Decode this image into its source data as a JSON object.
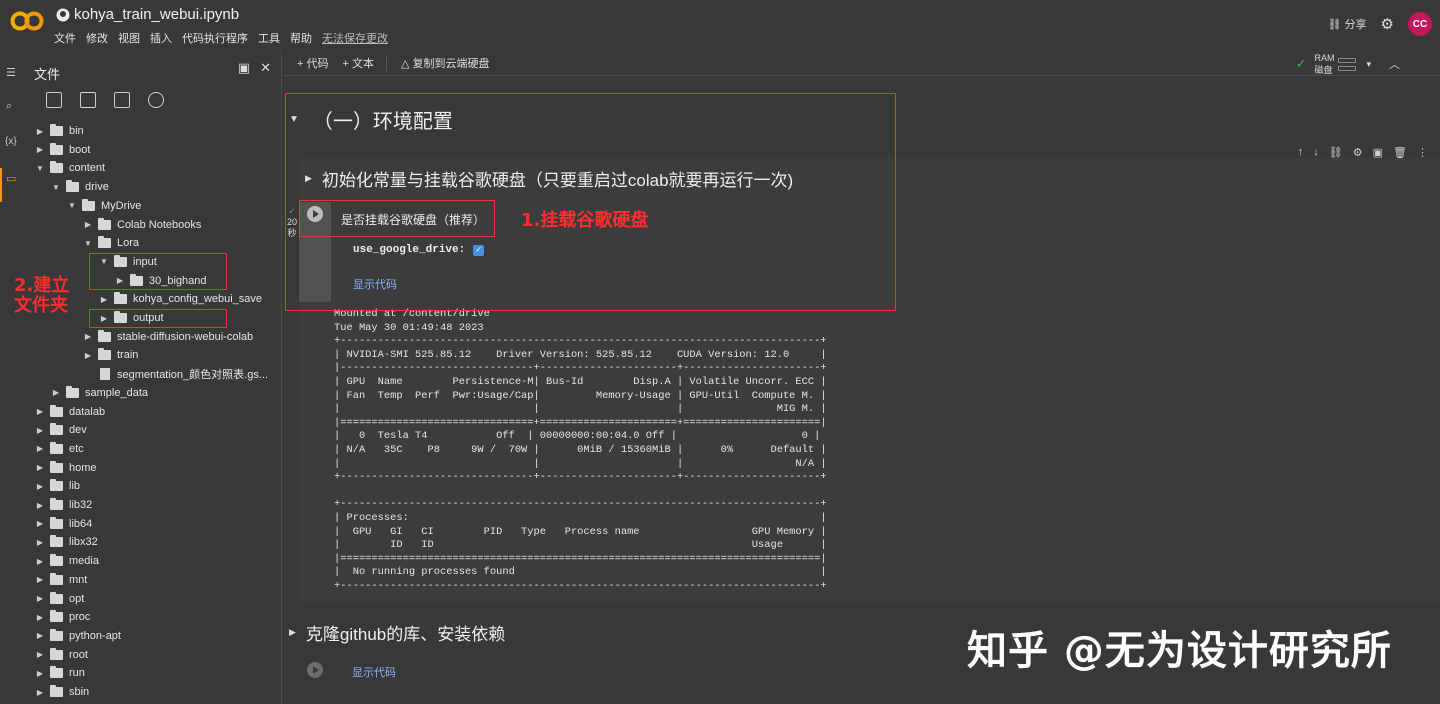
{
  "header": {
    "notebook_title": "kohya_train_webui.ipynb",
    "menu": [
      "文件",
      "修改",
      "视图",
      "插入",
      "代码执行程序",
      "工具",
      "帮助"
    ],
    "unsaved_notice": "无法保存更改",
    "share_label": "分享",
    "avatar_initials": "CC"
  },
  "sidebar": {
    "title": "文件",
    "tree": [
      {
        "label": "bin",
        "depth": 0,
        "expanded": false
      },
      {
        "label": "boot",
        "depth": 0,
        "expanded": false
      },
      {
        "label": "content",
        "depth": 0,
        "expanded": true
      },
      {
        "label": "drive",
        "depth": 1,
        "expanded": true
      },
      {
        "label": "MyDrive",
        "depth": 2,
        "expanded": true
      },
      {
        "label": "Colab Notebooks",
        "depth": 3,
        "expanded": false
      },
      {
        "label": "Lora",
        "depth": 3,
        "expanded": true
      },
      {
        "label": "input",
        "depth": 4,
        "expanded": true
      },
      {
        "label": "30_bighand",
        "depth": 5,
        "expanded": false
      },
      {
        "label": "kohya_config_webui_save",
        "depth": 4,
        "expanded": false
      },
      {
        "label": "output",
        "depth": 4,
        "expanded": false
      },
      {
        "label": "stable-diffusion-webui-colab",
        "depth": 3,
        "expanded": false
      },
      {
        "label": "train",
        "depth": 3,
        "expanded": false
      },
      {
        "label": "segmentation_颜色对照表.gs...",
        "depth": 3,
        "expanded": false,
        "file": true
      },
      {
        "label": "sample_data",
        "depth": 1,
        "expanded": false
      },
      {
        "label": "datalab",
        "depth": 0,
        "expanded": false
      },
      {
        "label": "dev",
        "depth": 0,
        "expanded": false
      },
      {
        "label": "etc",
        "depth": 0,
        "expanded": false
      },
      {
        "label": "home",
        "depth": 0,
        "expanded": false
      },
      {
        "label": "lib",
        "depth": 0,
        "expanded": false
      },
      {
        "label": "lib32",
        "depth": 0,
        "expanded": false
      },
      {
        "label": "lib64",
        "depth": 0,
        "expanded": false
      },
      {
        "label": "libx32",
        "depth": 0,
        "expanded": false
      },
      {
        "label": "media",
        "depth": 0,
        "expanded": false
      },
      {
        "label": "mnt",
        "depth": 0,
        "expanded": false
      },
      {
        "label": "opt",
        "depth": 0,
        "expanded": false
      },
      {
        "label": "proc",
        "depth": 0,
        "expanded": false
      },
      {
        "label": "python-apt",
        "depth": 0,
        "expanded": false
      },
      {
        "label": "root",
        "depth": 0,
        "expanded": false
      },
      {
        "label": "run",
        "depth": 0,
        "expanded": false
      },
      {
        "label": "sbin",
        "depth": 0,
        "expanded": false
      }
    ],
    "annotation": "2.建立\n文件夹"
  },
  "toolbar": {
    "add_code": "+ 代码",
    "add_text": "+ 文本",
    "copy_drive": "复制到云端硬盘",
    "ram_label": "RAM",
    "disk_label": "磁盘"
  },
  "notebook": {
    "section1_title": "（一）环境配置",
    "subsection_title": "初始化常量与挂载谷歌硬盘（只要重启过colab就要再运行一次)",
    "exec_time": "20\n秒",
    "form_label": "是否挂载谷歌硬盘（推荐）",
    "annotation1": "1.挂载谷歌硬盘",
    "param_name": "use_google_drive:",
    "show_code": "显示代码",
    "output": "Mounted at /content/drive\nTue May 30 01:49:48 2023\n+-----------------------------------------------------------------------------+\n| NVIDIA-SMI 525.85.12    Driver Version: 525.85.12    CUDA Version: 12.0     |\n|-------------------------------+----------------------+----------------------+\n| GPU  Name        Persistence-M| Bus-Id        Disp.A | Volatile Uncorr. ECC |\n| Fan  Temp  Perf  Pwr:Usage/Cap|         Memory-Usage | GPU-Util  Compute M. |\n|                               |                      |               MIG M. |\n|===============================+======================+======================|\n|   0  Tesla T4           Off  | 00000000:00:04.0 Off |                    0 |\n| N/A   35C    P8     9W /  70W |      0MiB / 15360MiB |      0%      Default |\n|                               |                      |                  N/A |\n+-------------------------------+----------------------+----------------------+\n\n+-----------------------------------------------------------------------------+\n| Processes:                                                                  |\n|  GPU   GI   CI        PID   Type   Process name                  GPU Memory |\n|        ID   ID                                                   Usage      |\n|=============================================================================|\n|  No running processes found                                                 |\n+-----------------------------------------------------------------------------+",
    "section2_title": "克隆github的库、安装依赖",
    "show_code2": "显示代码"
  },
  "watermark": "知乎 @无为设计研究所",
  "colors": {
    "accent_red": "#e53935",
    "link_blue": "#8ab4f8",
    "avatar": "#c2185b",
    "colab_orange": "#f29900"
  }
}
